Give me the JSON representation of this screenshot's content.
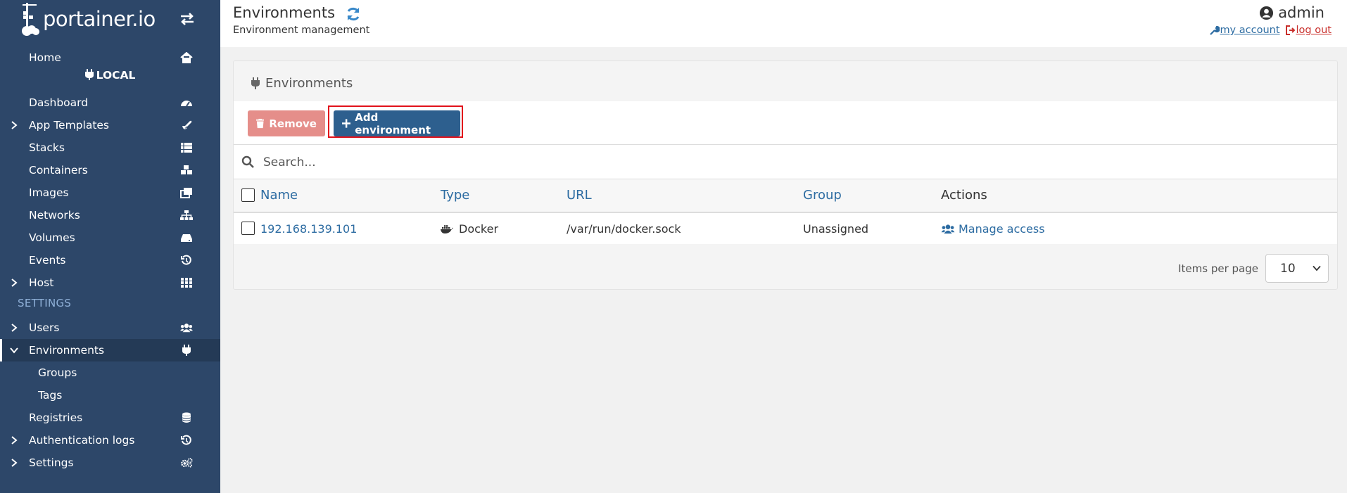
{
  "app": {
    "brand": "portainer.io"
  },
  "sidebar": {
    "home": "Home",
    "endpoint_name": "LOCAL",
    "items": [
      {
        "label": "Dashboard"
      },
      {
        "label": "App Templates"
      },
      {
        "label": "Stacks"
      },
      {
        "label": "Containers"
      },
      {
        "label": "Images"
      },
      {
        "label": "Networks"
      },
      {
        "label": "Volumes"
      },
      {
        "label": "Events"
      },
      {
        "label": "Host"
      }
    ],
    "settings_header": "SETTINGS",
    "settings_items": [
      {
        "label": "Users"
      },
      {
        "label": "Environments"
      },
      {
        "label": "Groups"
      },
      {
        "label": "Tags"
      },
      {
        "label": "Registries"
      },
      {
        "label": "Authentication logs"
      },
      {
        "label": "Settings"
      }
    ]
  },
  "header": {
    "title": "Environments",
    "subtitle": "Environment management",
    "user": "admin",
    "my_account": "my account",
    "log_out": "log out"
  },
  "widget": {
    "title": "Environments",
    "remove_label": "Remove",
    "add_label": "Add environment",
    "search_placeholder": "Search...",
    "columns": [
      "Name",
      "Type",
      "URL",
      "Group",
      "Actions"
    ],
    "rows": [
      {
        "name": "192.168.139.101",
        "type": "Docker",
        "url": "/var/run/docker.sock",
        "group": "Unassigned",
        "action": "Manage access"
      }
    ],
    "items_per_page_label": "Items per page",
    "items_per_page_value": "10"
  },
  "colors": {
    "sidebar_bg": "#2d4769",
    "accent": "#2d6ca2",
    "remove_button": "#e58e8a",
    "add_button": "#2d5f8e",
    "highlight_frame": "#e1111b"
  }
}
